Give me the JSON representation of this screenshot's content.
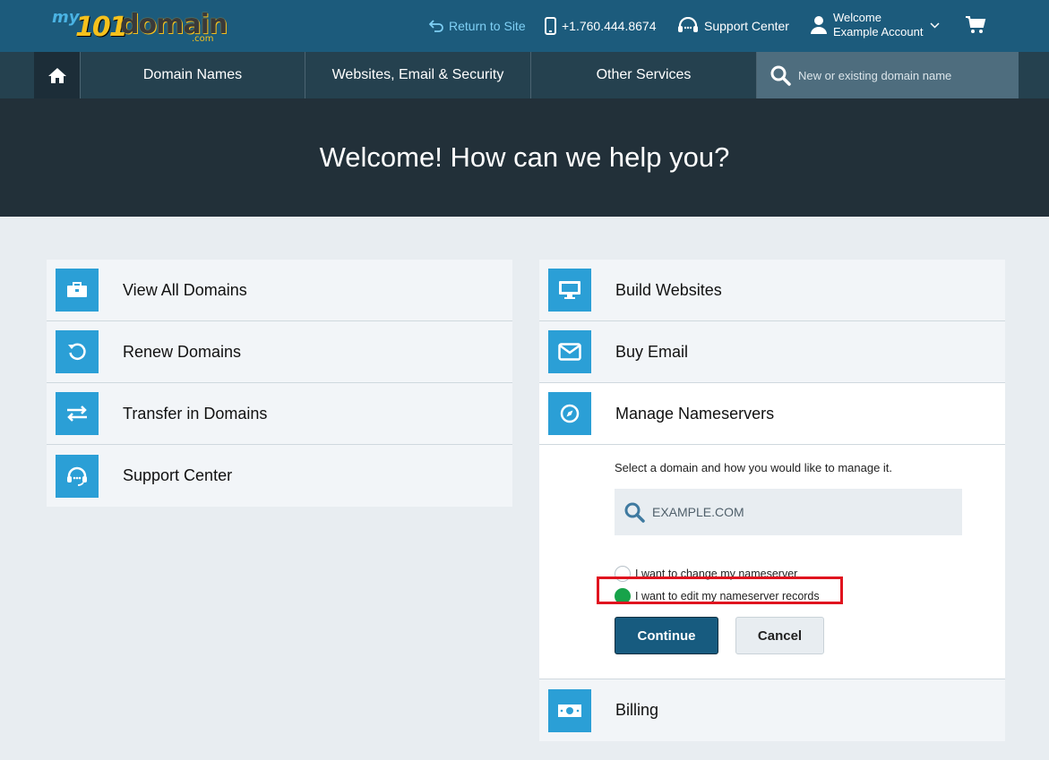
{
  "brand": {
    "logo_my": "my",
    "logo_num": "101",
    "logo_word": "domain",
    "logo_tld": ".com"
  },
  "topbar": {
    "return_label": "Return to Site",
    "phone": "+1.760.444.8674",
    "support_label": "Support Center",
    "welcome_line1": "Welcome",
    "welcome_line2": "Example Account"
  },
  "nav": {
    "items": [
      {
        "label": "Domain Names"
      },
      {
        "label": "Websites, Email & Security"
      },
      {
        "label": "Other Services"
      }
    ],
    "search_placeholder": "New or existing domain name"
  },
  "hero": {
    "title": "Welcome! How can we help you?"
  },
  "left_cards": [
    {
      "label": "View All Domains",
      "icon": "briefcase-icon"
    },
    {
      "label": "Renew Domains",
      "icon": "renew-icon"
    },
    {
      "label": "Transfer in Domains",
      "icon": "transfer-icon"
    },
    {
      "label": "Support Center",
      "icon": "headset-icon"
    }
  ],
  "right_cards": [
    {
      "label": "Build Websites",
      "icon": "monitor-icon"
    },
    {
      "label": "Buy Email",
      "icon": "envelope-icon"
    },
    {
      "label": "Manage Nameservers",
      "icon": "compass-icon"
    },
    {
      "label": "Billing",
      "icon": "money-icon"
    }
  ],
  "nameservers": {
    "hint": "Select a domain and how you would like to manage it.",
    "domain_placeholder": "EXAMPLE.COM",
    "option_change": "I want to change my nameserver",
    "option_edit": "I want to edit my nameserver records",
    "selected_option": "edit",
    "continue_label": "Continue",
    "cancel_label": "Cancel"
  },
  "colors": {
    "topbar": "#1c5b7c",
    "icon_bg": "#2b9fd6",
    "selected_radio": "#17a34a",
    "highlight": "#e0141f"
  }
}
